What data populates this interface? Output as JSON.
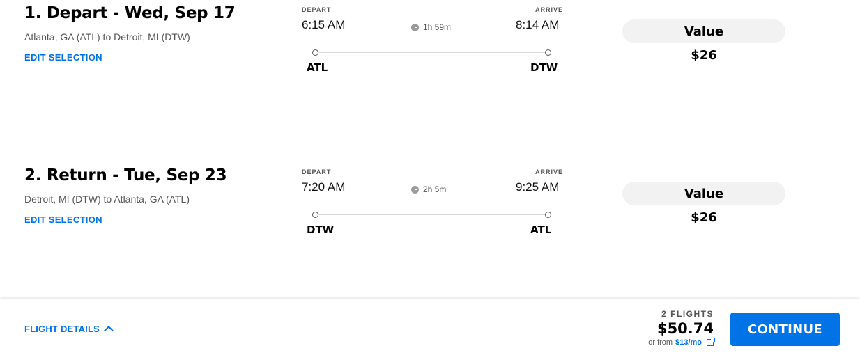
{
  "flights": [
    {
      "title": "1. Depart - Wed, Sep 17",
      "route": "Atlanta, GA (ATL) to Detroit, MI (DTW)",
      "edit_label": "EDIT SELECTION",
      "depart_label": "DEPART",
      "arrive_label": "ARRIVE",
      "depart_time": "6:15 AM",
      "arrive_time": "8:14 AM",
      "duration": "1h 59m",
      "origin_code": "ATL",
      "destination_code": "DTW",
      "fare_name": "Value",
      "fare_price": "$26"
    },
    {
      "title": "2. Return - Tue, Sep 23",
      "route": "Detroit, MI (DTW) to Atlanta, GA (ATL)",
      "edit_label": "EDIT SELECTION",
      "depart_label": "DEPART",
      "arrive_label": "ARRIVE",
      "depart_time": "7:20 AM",
      "arrive_time": "9:25 AM",
      "duration": "2h 5m",
      "origin_code": "DTW",
      "destination_code": "ATL",
      "fare_name": "Value",
      "fare_price": "$26"
    }
  ],
  "footer": {
    "flight_details_label": "FLIGHT DETAILS",
    "flights_count": "2 FLIGHTS",
    "total_price": "$50.74",
    "financing_prefix": "or from",
    "financing_amount": "$13/mo",
    "continue_label": "CONTINUE"
  },
  "icons": {
    "duration": "clock-icon",
    "expand": "chevron-up-icon",
    "external": "external-link-icon"
  },
  "colors": {
    "accent": "#0073e6",
    "pill_background": "#f2f2f2",
    "divider": "#d8d8d8"
  }
}
